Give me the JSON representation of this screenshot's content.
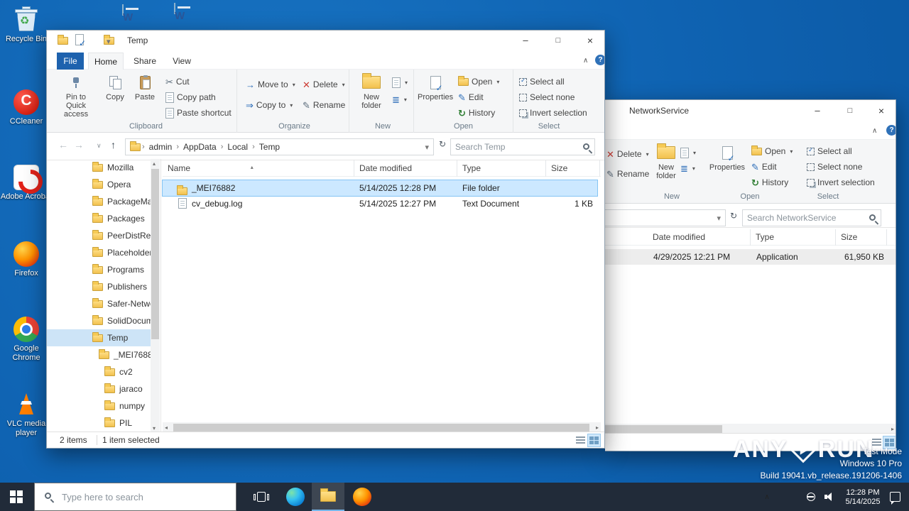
{
  "desktop": {
    "recycle_bin": {
      "label": "Recycle Bin"
    },
    "left_icons": [
      {
        "label": "CCleaner"
      },
      {
        "label": "Adobe Acrobat"
      },
      {
        "label": "Firefox"
      },
      {
        "label": "Google Chrome"
      },
      {
        "label": "VLC media player"
      }
    ]
  },
  "explorer": {
    "title": "Temp",
    "tabs": {
      "file": "File",
      "home": "Home",
      "share": "Share",
      "view": "View"
    },
    "ribbon": {
      "pin": "Pin to Quick access",
      "copy": "Copy",
      "paste": "Paste",
      "cut": "Cut",
      "copy_path": "Copy path",
      "paste_shortcut": "Paste shortcut",
      "clipboard_group": "Clipboard",
      "move_to": "Move to",
      "copy_to": "Copy to",
      "delete": "Delete",
      "rename": "Rename",
      "organize_group": "Organize",
      "new_folder": "New folder",
      "new_group": "New",
      "properties": "Properties",
      "open": "Open",
      "edit": "Edit",
      "history": "History",
      "open_group": "Open",
      "select_all": "Select all",
      "select_none": "Select none",
      "invert_selection": "Invert selection",
      "select_group": "Select"
    },
    "address": {
      "crumbs": [
        "admin",
        "AppData",
        "Local",
        "Temp"
      ]
    },
    "search_placeholder": "Search Temp",
    "nav_items": [
      {
        "label": "Mozilla"
      },
      {
        "label": "Opera"
      },
      {
        "label": "PackageMa..."
      },
      {
        "label": "Packages"
      },
      {
        "label": "PeerDistRep..."
      },
      {
        "label": "Placeholder..."
      },
      {
        "label": "Programs"
      },
      {
        "label": "Publishers"
      },
      {
        "label": "Safer-Netwo..."
      },
      {
        "label": "SolidDocum..."
      },
      {
        "label": "Temp"
      },
      {
        "label": "_MEI76882"
      },
      {
        "label": "cv2"
      },
      {
        "label": "jaraco"
      },
      {
        "label": "numpy"
      },
      {
        "label": "PIL"
      }
    ],
    "columns": {
      "name": "Name",
      "date": "Date modified",
      "type": "Type",
      "size": "Size"
    },
    "files": [
      {
        "name": "_MEI76882",
        "date": "5/14/2025 12:28 PM",
        "type": "File folder",
        "size": ""
      },
      {
        "name": "cv_debug.log",
        "date": "5/14/2025 12:27 PM",
        "type": "Text Document",
        "size": "1 KB"
      }
    ],
    "status": {
      "count": "2 items",
      "selected": "1 item selected"
    }
  },
  "back_window": {
    "title": "NetworkService",
    "ribbon": {
      "delete": "Delete",
      "rename": "Rename",
      "new_folder": "New folder",
      "new_group": "New",
      "properties": "Properties",
      "open": "Open",
      "edit": "Edit",
      "history": "History",
      "open_group": "Open",
      "select_all": "Select all",
      "select_none": "Select none",
      "invert_selection": "Invert selection",
      "select_group": "Select"
    },
    "search_placeholder": "Search NetworkService",
    "columns": {
      "date": "Date modified",
      "type": "Type",
      "size": "Size"
    },
    "files": [
      {
        "date": "4/29/2025 12:21 PM",
        "type": "Application",
        "size": "61,950 KB"
      }
    ]
  },
  "taskbar": {
    "search_placeholder": "Type here to search",
    "clock": {
      "time": "12:28 PM",
      "date": "5/14/2025"
    }
  },
  "watermark": {
    "brand_left": "ANY",
    "brand_right": "RUN",
    "line1": "Test Mode",
    "line2": "Windows 10 Pro",
    "line3": "Build 19041.vb_release.191206-1406"
  }
}
